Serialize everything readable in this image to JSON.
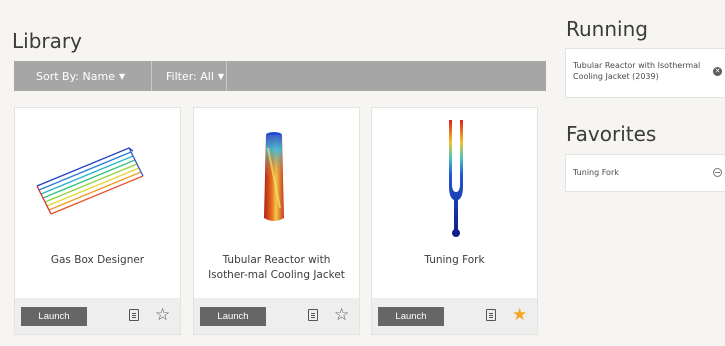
{
  "library": {
    "title": "Library",
    "sort_label": "Sort By: Name",
    "filter_label": "Filter: All"
  },
  "cards": [
    {
      "name": "Gas Box Designer",
      "launch_label": "Launch",
      "favorited": false,
      "thumbnail": "gas-box-icon"
    },
    {
      "name": "Tubular Reactor with Isother-mal Cooling Jacket",
      "launch_label": "Launch",
      "favorited": false,
      "thumbnail": "tubular-reactor-icon"
    },
    {
      "name": "Tuning Fork",
      "launch_label": "Launch",
      "favorited": true,
      "thumbnail": "tuning-fork-icon"
    }
  ],
  "running": {
    "title": "Running",
    "items": [
      {
        "label": "Tubular Reactor with Isothermal Cooling Jacket (2039)"
      }
    ]
  },
  "favorites": {
    "title": "Favorites",
    "items": [
      {
        "label": "Tuning Fork"
      }
    ]
  },
  "colors": {
    "toolbar": "#a6a6a6",
    "launch": "#666666",
    "star_active": "#f5a623"
  }
}
